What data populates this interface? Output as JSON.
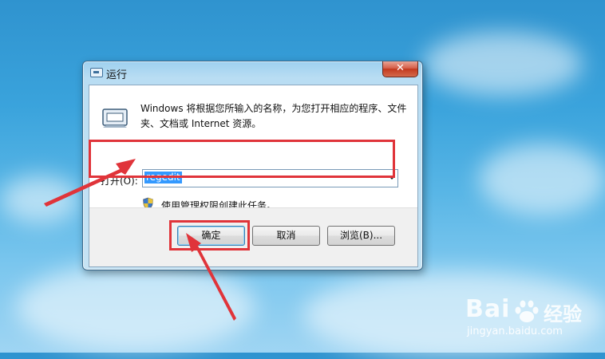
{
  "window": {
    "title": "运行",
    "close_label": "✕"
  },
  "content": {
    "description": "Windows 将根据您所输入的名称，为您打开相应的程序、文件夹、文档或 Internet 资源。",
    "open_label": "打开(O):",
    "command_value": "regedit",
    "admin_text": "使用管理权限创建此任务。"
  },
  "buttons": {
    "ok": "确定",
    "cancel": "取消",
    "browse": "浏览(B)..."
  },
  "watermark": {
    "brand": "Bai",
    "brand_cn": "经验",
    "url": "jingyan.baidu.com"
  },
  "colors": {
    "highlight": "#e0343a",
    "selection": "#3399ff"
  }
}
